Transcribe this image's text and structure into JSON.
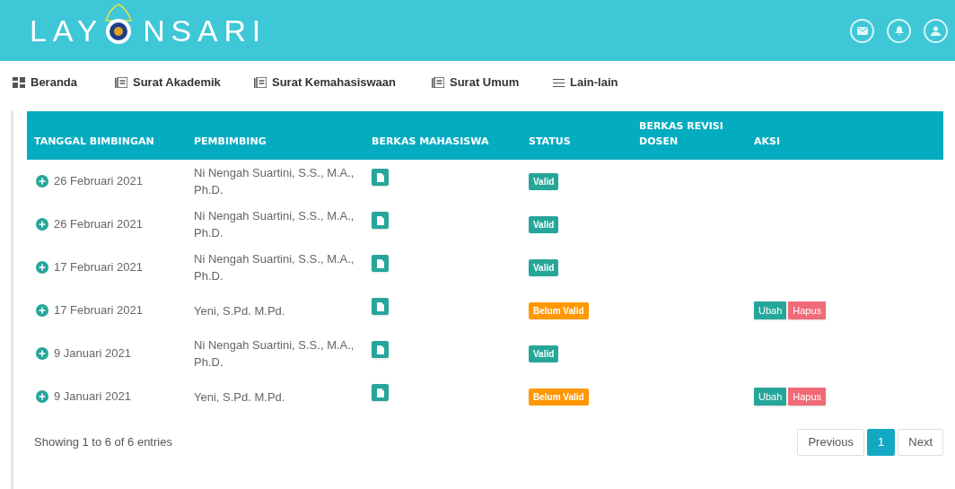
{
  "logo": {
    "text_before": "LAY",
    "text_after": "NSARI"
  },
  "nav": [
    {
      "label": "Beranda",
      "kind": "home"
    },
    {
      "label": "Surat Akademik",
      "kind": "letters"
    },
    {
      "label": "Surat Kemahasiswaan",
      "kind": "letters"
    },
    {
      "label": "Surat Umum",
      "kind": "letters"
    },
    {
      "label": "Lain-lain",
      "kind": "other"
    }
  ],
  "table": {
    "columns": [
      "TANGGAL BIMBINGAN",
      "PEMBIMBING",
      "BERKAS MAHASISWA",
      "STATUS",
      "BERKAS REVISI DOSEN",
      "AKSI"
    ],
    "rows": [
      {
        "date": "26 Februari 2021",
        "advisor": "Ni Nengah Suartini, S.S., M.A., Ph.D.",
        "status": {
          "kind": "valid",
          "label": "Valid"
        },
        "actions": []
      },
      {
        "date": "26 Februari 2021",
        "advisor": "Ni Nengah Suartini, S.S., M.A., Ph.D.",
        "status": {
          "kind": "valid",
          "label": "Valid"
        },
        "actions": []
      },
      {
        "date": "17 Februari 2021",
        "advisor": "Ni Nengah Suartini, S.S., M.A., Ph.D.",
        "status": {
          "kind": "valid",
          "label": "Valid"
        },
        "actions": []
      },
      {
        "date": "17 Februari 2021",
        "advisor": "Yeni, S.Pd. M.Pd.",
        "status": {
          "kind": "invalid",
          "label": "Belum Valid"
        },
        "actions": [
          {
            "kind": "edit",
            "label": "Ubah"
          },
          {
            "kind": "delete",
            "label": "Hapus"
          }
        ]
      },
      {
        "date": "9 Januari 2021",
        "advisor": "Ni Nengah Suartini, S.S., M.A., Ph.D.",
        "status": {
          "kind": "valid",
          "label": "Valid"
        },
        "actions": []
      },
      {
        "date": "9 Januari 2021",
        "advisor": "Yeni, S.Pd. M.Pd.",
        "status": {
          "kind": "invalid",
          "label": "Belum Valid"
        },
        "actions": [
          {
            "kind": "edit",
            "label": "Ubah"
          },
          {
            "kind": "delete",
            "label": "Hapus"
          }
        ]
      }
    ]
  },
  "info": "Showing 1 to 6 of 6 entries",
  "pagination": [
    {
      "label": "Previous",
      "selected": false
    },
    {
      "label": "1",
      "selected": true
    },
    {
      "label": "Next",
      "selected": false
    }
  ]
}
